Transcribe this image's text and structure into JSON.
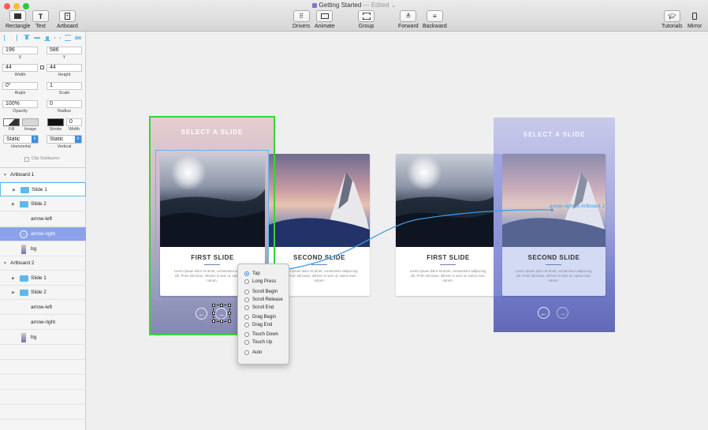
{
  "window": {
    "title": "Getting Started",
    "edited": "— Edited ⌄"
  },
  "toolbar": {
    "rectangle": "Rectangle",
    "text": "Text",
    "artboard": "Artboard",
    "drivers": "Drivers",
    "animate": "Animate",
    "group": "Group",
    "forward": "Forward",
    "backward": "Backward",
    "tutorials": "Tutorials",
    "mirror": "Mirror"
  },
  "inspector": {
    "x_value": "196",
    "x_label": "X",
    "y_value": "586",
    "y_label": "Y",
    "width_value": "44",
    "width_label": "Width",
    "height_value": "44",
    "height_label": "Height",
    "angle_value": "0°",
    "angle_label": "Angle",
    "scale_value": "1",
    "scale_label": "Scale",
    "opacity_value": "100%",
    "opacity_label": "Opacity",
    "radius_value": "0",
    "radius_label": "Radius",
    "fill_label": "Fill",
    "image_label": "Image",
    "stroke_label": "Stroke",
    "stroke_width_value": "0",
    "stroke_width_label": "Width",
    "horizontal_value": "Static",
    "horizontal_label": "Horizontal",
    "vertical_value": "Static",
    "vertical_label": "Vertical",
    "clip_sublayers": "Clip Sublayers"
  },
  "layers": {
    "artboard1": "Artboard 1",
    "slide1": "Slide 1",
    "slide2": "Slide 2",
    "arrow_left": "arrow-left",
    "arrow_right": "arrow-right",
    "bg": "bg",
    "artboard2": "Artboard 2"
  },
  "artboard": {
    "heading": "SELECT A SLIDE",
    "first_slide": "FIRST SLIDE",
    "second_slide": "SECOND SLIDE",
    "body": "Lorem ipsum dolor sit amet, consectetur adipiscing elit. Proin elit lacus, ultrices in sem ut, varius nunc rutrum."
  },
  "connection_label": "arrow-right to Artboard 2",
  "context_menu": {
    "items": [
      "Tap",
      "Long Press",
      "Scroll Begin",
      "Scroll Release",
      "Scroll End",
      "Drag Begin",
      "Drag End",
      "Touch Down",
      "Touch Up",
      "Auto"
    ]
  },
  "colors": {
    "accent": "#5fb8ec",
    "selection_green": "#38d438",
    "highlight": "#8ba2ea",
    "card_line": "#6a7fb5"
  }
}
